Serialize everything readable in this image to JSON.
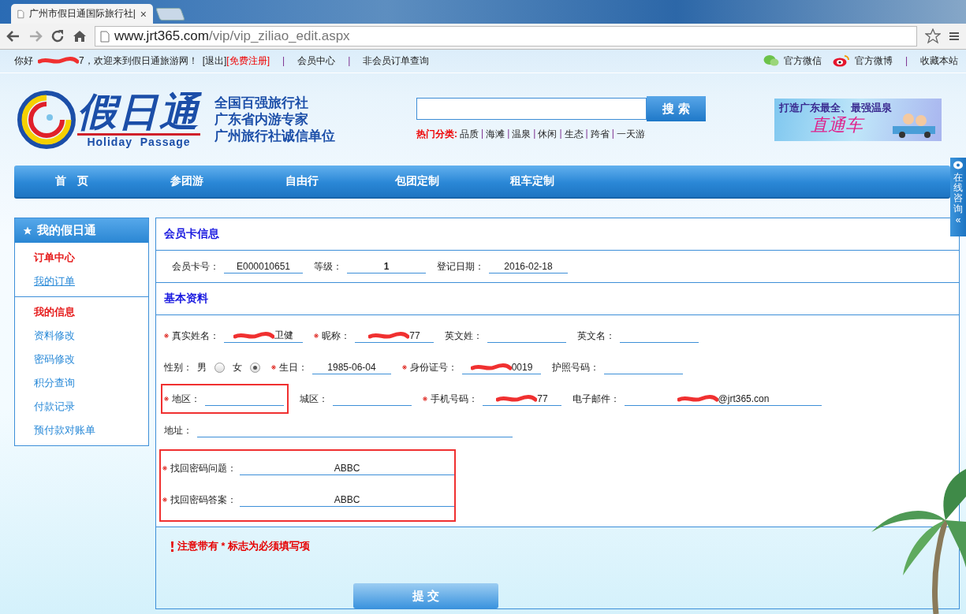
{
  "browser": {
    "tab_title": "广州市假日通国际旅行社|",
    "tab_close": "×",
    "url_host": "www.jrt365.com",
    "url_path": "/vip/vip_ziliao_edit.aspx"
  },
  "top_bar": {
    "greeting": "你好",
    "greeting_rest": "7，欢迎来到假日通旅游网！",
    "logout": "[退出]",
    "register": "[免费注册]",
    "separator": "|",
    "links": [
      "会员中心",
      "非会员订单查询"
    ],
    "wechat": "官方微信",
    "weibo": "官方微博",
    "bookmark": "收藏本站"
  },
  "header": {
    "logo_text": "假日通",
    "logo_subtitle": "Holiday  Passage",
    "slogans": [
      "全国百强旅行社",
      "广东省内游专家",
      "广州旅行社诚信单位"
    ],
    "search": {
      "button": "搜 索"
    },
    "hot_label": "热门分类:",
    "hot_items": [
      "品质",
      "海滩",
      "温泉",
      "休闲",
      "生态",
      "跨省",
      "一天游"
    ],
    "banner": {
      "headline": "打造广东最全、最强温泉",
      "subline": "直通车"
    }
  },
  "nav": [
    {
      "label": "首　页"
    },
    {
      "label": "参团游"
    },
    {
      "label": "自由行"
    },
    {
      "label": "包团定制"
    },
    {
      "label": "租车定制"
    }
  ],
  "side_tab": {
    "label": "在线咨询",
    "glyph": "«"
  },
  "sidebar": {
    "title": "我的假日通",
    "groups": [
      [
        {
          "kind": "heading",
          "label": "订单中心",
          "selected": false
        },
        {
          "kind": "link",
          "label": "我的订单",
          "selected": true
        }
      ],
      [
        {
          "kind": "heading",
          "label": "我的信息",
          "selected": false
        },
        {
          "kind": "link",
          "label": "资料修改",
          "selected": false
        },
        {
          "kind": "link",
          "label": "密码修改",
          "selected": false
        },
        {
          "kind": "link",
          "label": "积分查询",
          "selected": false
        },
        {
          "kind": "link",
          "label": "付款记录",
          "selected": false
        },
        {
          "kind": "link",
          "label": "预付款对账单",
          "selected": false
        }
      ]
    ]
  },
  "card_section": {
    "title": "会员卡信息",
    "fields": [
      {
        "label": "会员卡号：",
        "value": "E000010651",
        "bold": false
      },
      {
        "label": "等级：",
        "value": "1",
        "bold": true
      },
      {
        "label": "登记日期：",
        "value": "2016-02-18",
        "bold": false
      }
    ]
  },
  "basic_section": {
    "title": "基本资料",
    "rows": [
      [
        {
          "kind": "text",
          "label": "真实姓名：",
          "required": true,
          "redacted": true,
          "value": "卫健",
          "highlighted": false
        },
        {
          "kind": "text",
          "label": "昵称：",
          "required": true,
          "redacted": true,
          "value": "77",
          "highlighted": false
        },
        {
          "kind": "text",
          "label": "英文姓：",
          "required": false,
          "redacted": false,
          "highlighted": false
        },
        {
          "kind": "text",
          "label": "英文名：",
          "required": false,
          "redacted": false,
          "highlighted": false
        }
      ],
      [
        {
          "kind": "radio",
          "label": "性别：",
          "required": false,
          "options": [
            {
              "label": "男",
              "selected": false
            },
            {
              "label": "女",
              "selected": true
            }
          ]
        },
        {
          "kind": "text",
          "label": "生日：",
          "required": true,
          "redacted": false,
          "value": "1985-06-04",
          "highlighted": false
        },
        {
          "kind": "text",
          "label": "身份证号：",
          "required": true,
          "redacted": true,
          "value": "0019",
          "highlighted": false
        },
        {
          "kind": "text",
          "label": "护照号码：",
          "required": false,
          "redacted": false,
          "highlighted": false
        }
      ],
      [
        {
          "kind": "text",
          "label": "地区：",
          "required": true,
          "redacted": false,
          "highlighted": true
        },
        {
          "kind": "text",
          "label": "城区：",
          "required": false,
          "redacted": false,
          "highlighted": false
        },
        {
          "kind": "text",
          "label": "手机号码：",
          "required": true,
          "redacted": true,
          "value": "77",
          "highlighted": false
        },
        {
          "kind": "wide_text",
          "label": "电子邮件：",
          "required": false,
          "redacted": true,
          "value": "@jrt365.con",
          "highlighted": false
        }
      ],
      [
        {
          "kind": "long_text",
          "label": "地址：",
          "required": false,
          "redacted": false,
          "highlighted": false
        }
      ]
    ],
    "security": {
      "highlighted": true,
      "fields": [
        {
          "label": "找回密码问题：",
          "required": true,
          "value": "ABBC"
        },
        {
          "label": "找回密码答案：",
          "required": true,
          "value": "ABBC"
        }
      ]
    }
  },
  "notice": "注意带有 * 标志为必须填写项",
  "submit": "提 交"
}
